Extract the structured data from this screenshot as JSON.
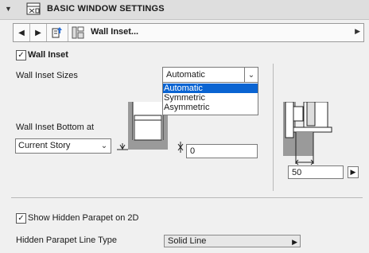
{
  "header": {
    "title": "BASIC WINDOW SETTINGS",
    "collapse_glyph": "▼",
    "icon": "window-settings-icon"
  },
  "toolbar": {
    "prev_glyph": "◀",
    "next_glyph": "▶",
    "favorites_icon": "favorites-icon",
    "tool_icon": "wall-inset-icon",
    "title": "Wall Inset...",
    "expand_glyph": "▶"
  },
  "wall_inset": {
    "checkbox_label": "Wall Inset",
    "checked": true,
    "sizes_label": "Wall Inset Sizes",
    "sizes_value": "Automatic",
    "sizes_options": [
      "Automatic",
      "Symmetric",
      "Asymmetric"
    ],
    "selected_index": 0,
    "bottom_label": "Wall Inset Bottom at",
    "bottom_value": "Current Story",
    "bottom_offset_value": "0",
    "depth_value": "50"
  },
  "parapet": {
    "checkbox_label": "Show Hidden Parapet on 2D",
    "checked": true,
    "line_type_label": "Hidden Parapet Line Type",
    "line_type_value": "Solid Line"
  },
  "glyphs": {
    "check": "✓",
    "dropdown": "⌄",
    "small_arrow": "▶"
  },
  "colors": {
    "selection": "#0a64d2",
    "header_bg": "#dedede",
    "panel_bg": "#f0f0f0"
  }
}
